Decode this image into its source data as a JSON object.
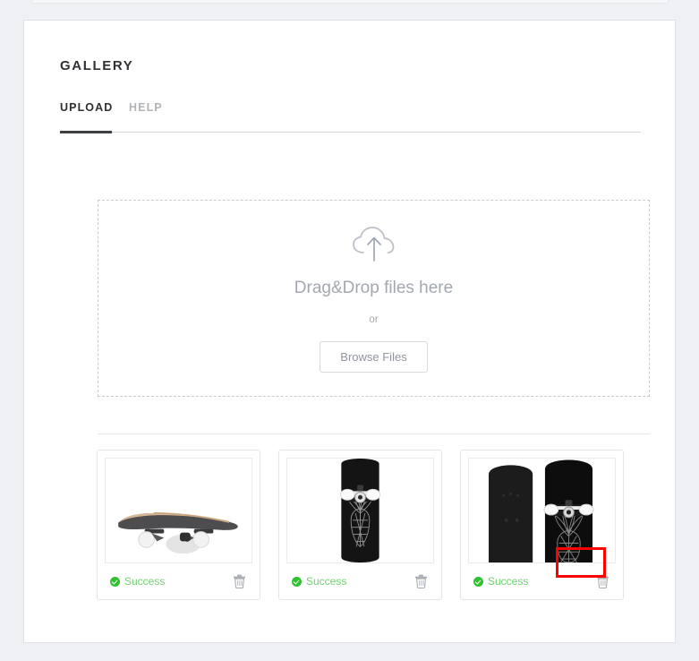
{
  "page": {
    "title": "GALLERY",
    "background_color": "#eff0f4",
    "card_background": "#ffffff"
  },
  "tabs": [
    {
      "label": "UPLOAD",
      "active": true
    },
    {
      "label": "HELP",
      "active": false
    }
  ],
  "dropzone": {
    "icon": "cloud-upload-icon",
    "title": "Drag&Drop files here",
    "or_label": "or",
    "browse_label": "Browse Files",
    "border_style": "dashed"
  },
  "files": [
    {
      "thumbnail": "skateboard-deck-side-view",
      "status_label": "Success",
      "status_color": "#6fd06f",
      "delete_icon": "trash-icon",
      "highlighted": false
    },
    {
      "thumbnail": "black-skateboard-pineapple-graphic",
      "status_label": "Success",
      "status_color": "#6fd06f",
      "delete_icon": "trash-icon",
      "highlighted": false
    },
    {
      "thumbnail": "two-black-skateboards-pair",
      "status_label": "Success",
      "status_color": "#6fd06f",
      "delete_icon": "trash-icon",
      "highlighted": true
    }
  ],
  "annotation": {
    "type": "highlight-rectangle",
    "color": "#ff0000",
    "target": "delete-button-file-3"
  }
}
